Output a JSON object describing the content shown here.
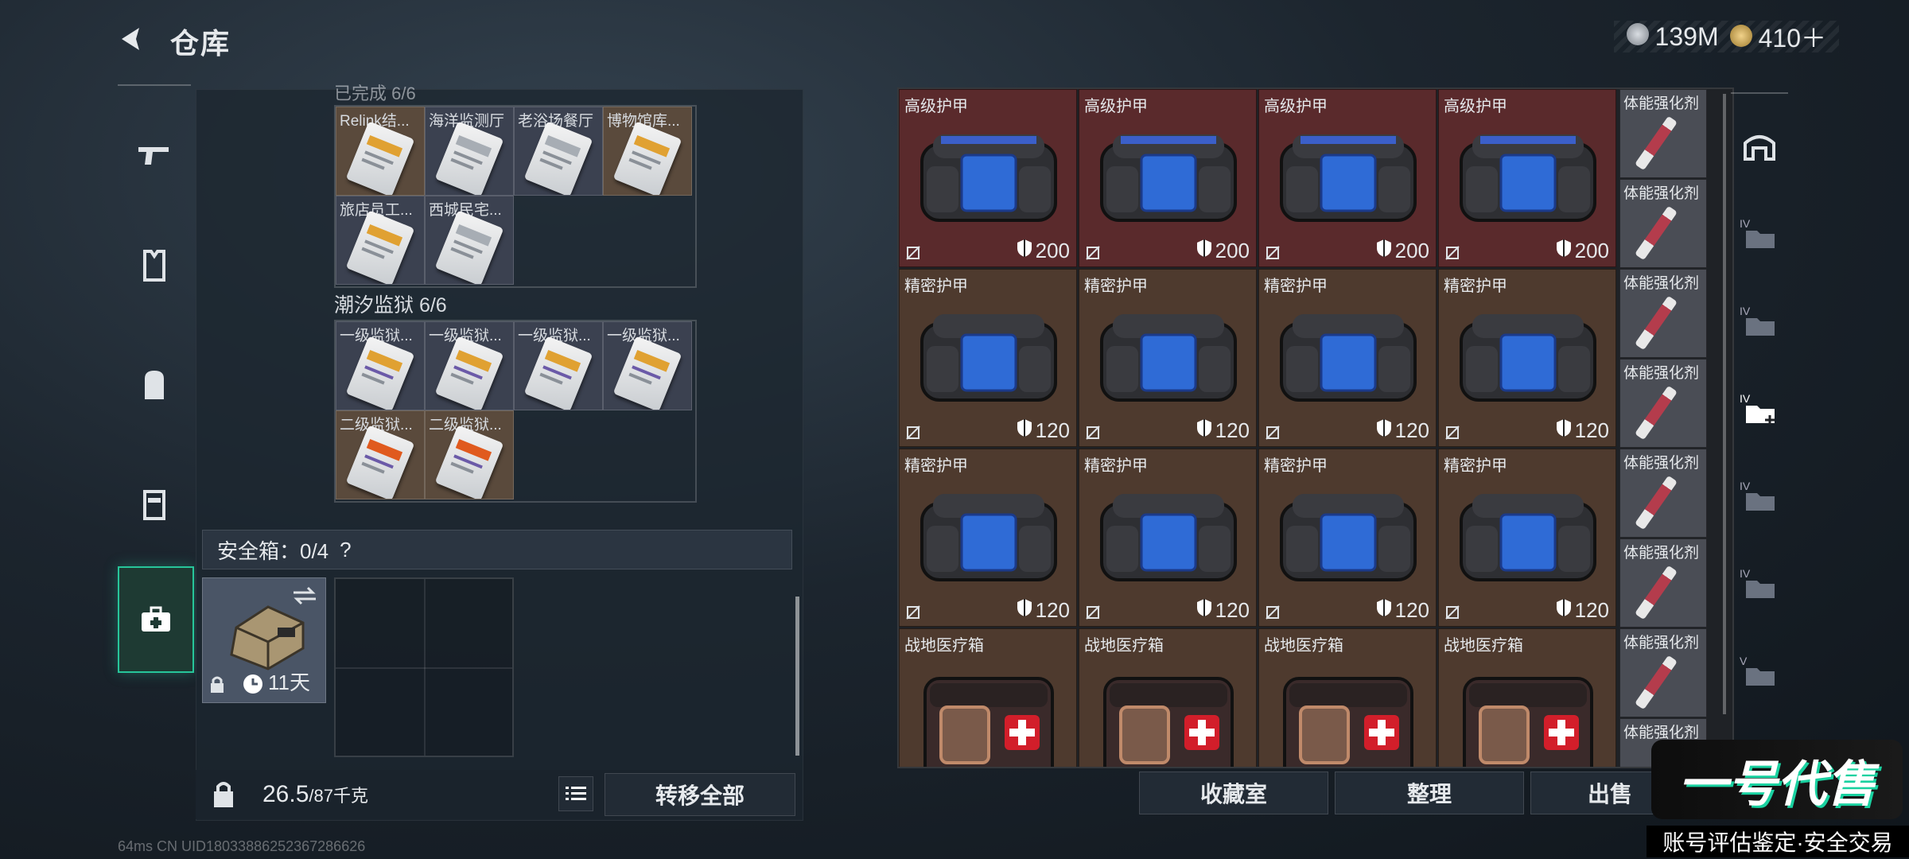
{
  "header": {
    "title": "仓库",
    "currency_silver": "139M",
    "currency_gold": "410＋"
  },
  "left_panel": {
    "sections": [
      {
        "name": "已完成 6/6",
        "items": [
          "Relink结...",
          "海洋监测厅",
          "老浴场餐厅",
          "博物馆库...",
          "旅店员工...",
          "西城民宅..."
        ]
      },
      {
        "name": "潮汐监狱 6/6",
        "items": [
          "一级监狱...",
          "一级监狱...",
          "一级监狱...",
          "一级监狱...",
          "二级监狱...",
          "二级监狱..."
        ]
      }
    ],
    "safe_box": {
      "label": "安全箱：0/4",
      "help": "?",
      "days": "11天"
    },
    "weight_value": "26.5",
    "weight_capacity": "/87千克",
    "transfer_all": "转移全部"
  },
  "right_panel": {
    "rows": [
      {
        "name": "高级护甲",
        "durability": "200",
        "bg": "#5a2a2c",
        "type": "armor-hi"
      },
      {
        "name": "精密护甲",
        "durability": "120",
        "bg": "#4e3a2e",
        "type": "armor"
      },
      {
        "name": "精密护甲",
        "durability": "120",
        "bg": "#4e3a2e",
        "type": "armor"
      },
      {
        "name": "战地医疗箱",
        "durability": "",
        "bg": "#4e3a2e",
        "type": "medkit"
      }
    ],
    "stim_name": "体能强化剂",
    "buttons": {
      "collection": "收藏室",
      "organize": "整理",
      "sell": "出售"
    }
  },
  "watermark": {
    "brand": "一号代售",
    "slogan": "账号评估鉴定·安全交易"
  },
  "footer": {
    "text": "64ms    CN UID18033886252367286626"
  },
  "icons": [
    "back-icon",
    "rifle-icon",
    "vest-icon",
    "backpack-icon",
    "case-icon",
    "medkit-icon",
    "lock-icon",
    "clock-icon",
    "swap-icon",
    "list-icon",
    "shield-icon",
    "no-durability-icon",
    "home-icon",
    "folder-icon"
  ]
}
